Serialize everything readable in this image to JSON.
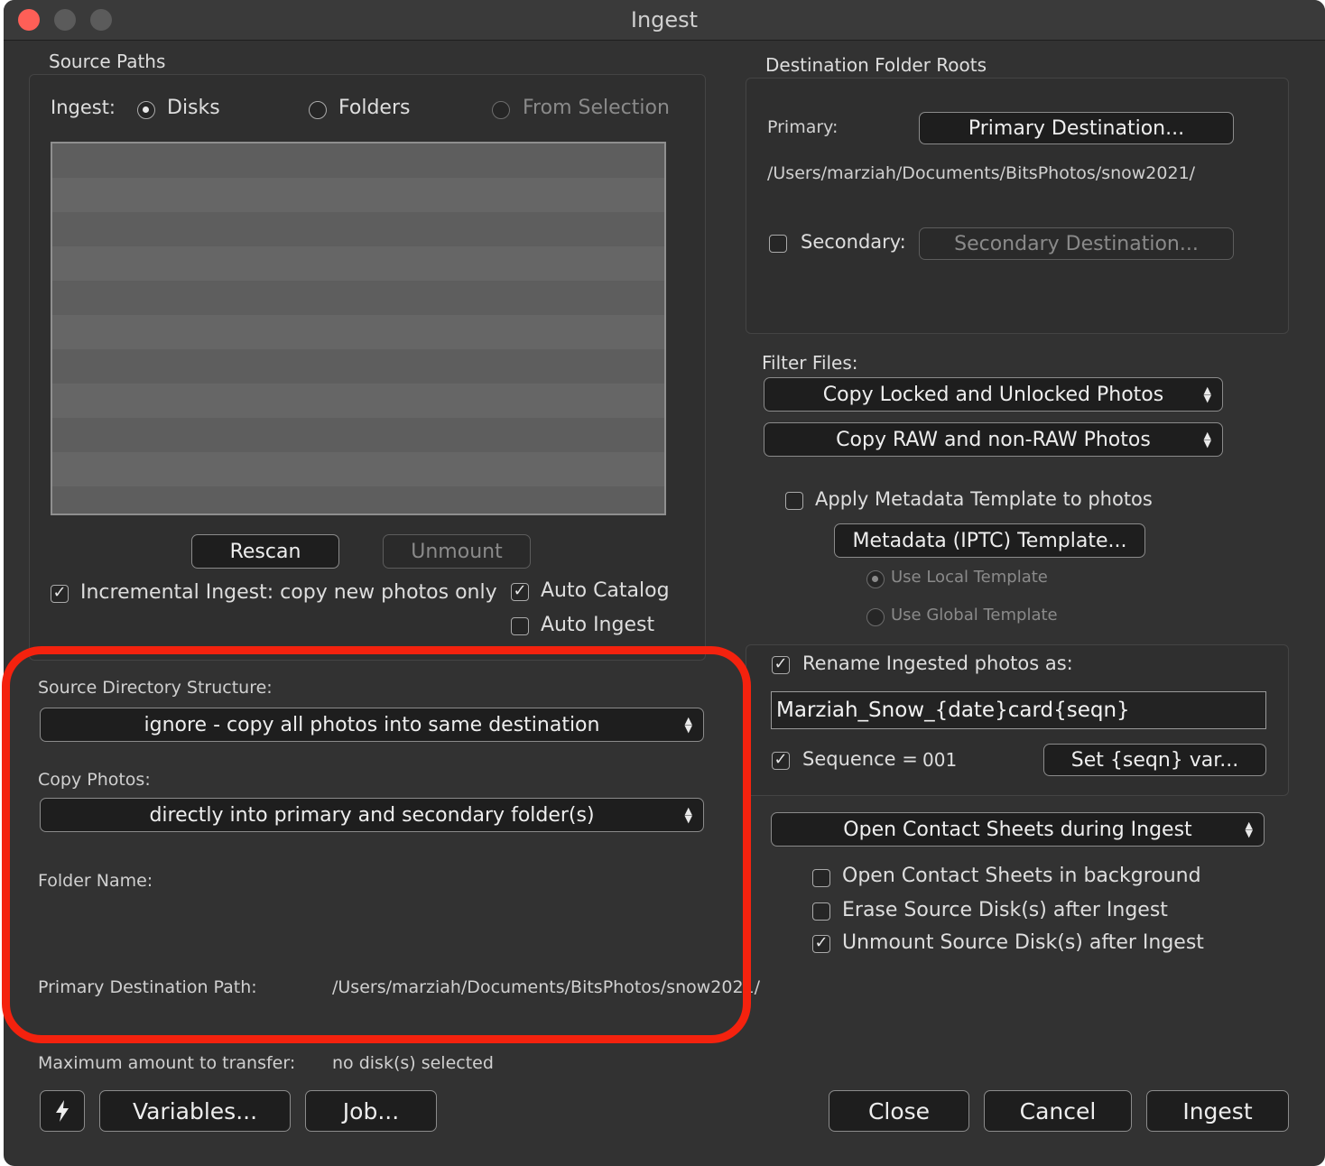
{
  "window": {
    "title": "Ingest",
    "traffic_colors": [
      "#fe5f57",
      "#5b5b5b",
      "#5b5b5b"
    ]
  },
  "source": {
    "group_title": "Source Paths",
    "ingest_label": "Ingest:",
    "options": [
      {
        "label": "Disks",
        "selected": true,
        "enabled": true
      },
      {
        "label": "Folders",
        "selected": false,
        "enabled": true
      },
      {
        "label": "From Selection",
        "selected": false,
        "enabled": false
      }
    ],
    "rescan": "Rescan",
    "unmount": "Unmount",
    "incremental": {
      "label": "Incremental Ingest: copy new photos only",
      "checked": true
    },
    "auto_catalog": {
      "label": "Auto Catalog",
      "checked": true
    },
    "auto_ingest": {
      "label": "Auto Ingest",
      "checked": false
    }
  },
  "structure": {
    "source_dir_label": "Source Directory Structure:",
    "source_dir_value": "ignore - copy all photos into same destination",
    "copy_label": "Copy Photos:",
    "copy_value": "directly into primary and secondary folder(s)",
    "folder_name_label": "Folder Name:",
    "primary_path_label": "Primary Destination Path:",
    "primary_path_value": "/Users/marziah/Documents/BitsPhotos/snow2021/",
    "max_label": "Maximum amount to transfer:",
    "max_value": "no disk(s) selected"
  },
  "destination": {
    "group_title": "Destination Folder Roots",
    "primary_label": "Primary:",
    "primary_button": "Primary Destination...",
    "primary_path": "/Users/marziah/Documents/BitsPhotos/snow2021/",
    "secondary_label": "Secondary:",
    "secondary_button": "Secondary Destination...",
    "secondary_checked": false
  },
  "filter": {
    "label": "Filter Files:",
    "locked_value": "Copy Locked and Unlocked Photos",
    "raw_value": "Copy RAW and non-RAW Photos"
  },
  "metadata": {
    "apply_label": "Apply Metadata Template to photos",
    "apply_checked": false,
    "template_button": "Metadata (IPTC) Template...",
    "local": "Use Local Template",
    "global": "Use Global Template",
    "local_selected": true
  },
  "rename": {
    "label": "Rename Ingested photos as:",
    "checked": true,
    "pattern": "Marziah_Snow_{date}card{seqn}",
    "sequence_label": "Sequence =",
    "sequence_checked": true,
    "sequence_value": "001",
    "set_button": "Set {seqn} var..."
  },
  "contact": {
    "popup_value": "Open Contact Sheets during Ingest",
    "background": {
      "label": "Open Contact Sheets in background",
      "checked": false
    },
    "erase": {
      "label": "Erase Source Disk(s) after Ingest",
      "checked": false
    },
    "unmount": {
      "label": "Unmount Source Disk(s) after Ingest",
      "checked": true
    }
  },
  "footer": {
    "lightning_icon": "lightning-icon",
    "variables": "Variables...",
    "job": "Job...",
    "close": "Close",
    "cancel": "Cancel",
    "ingest": "Ingest"
  },
  "annotation": {
    "highlight_color": "#f4220e"
  },
  "icons": {
    "checkmark": "✓"
  }
}
